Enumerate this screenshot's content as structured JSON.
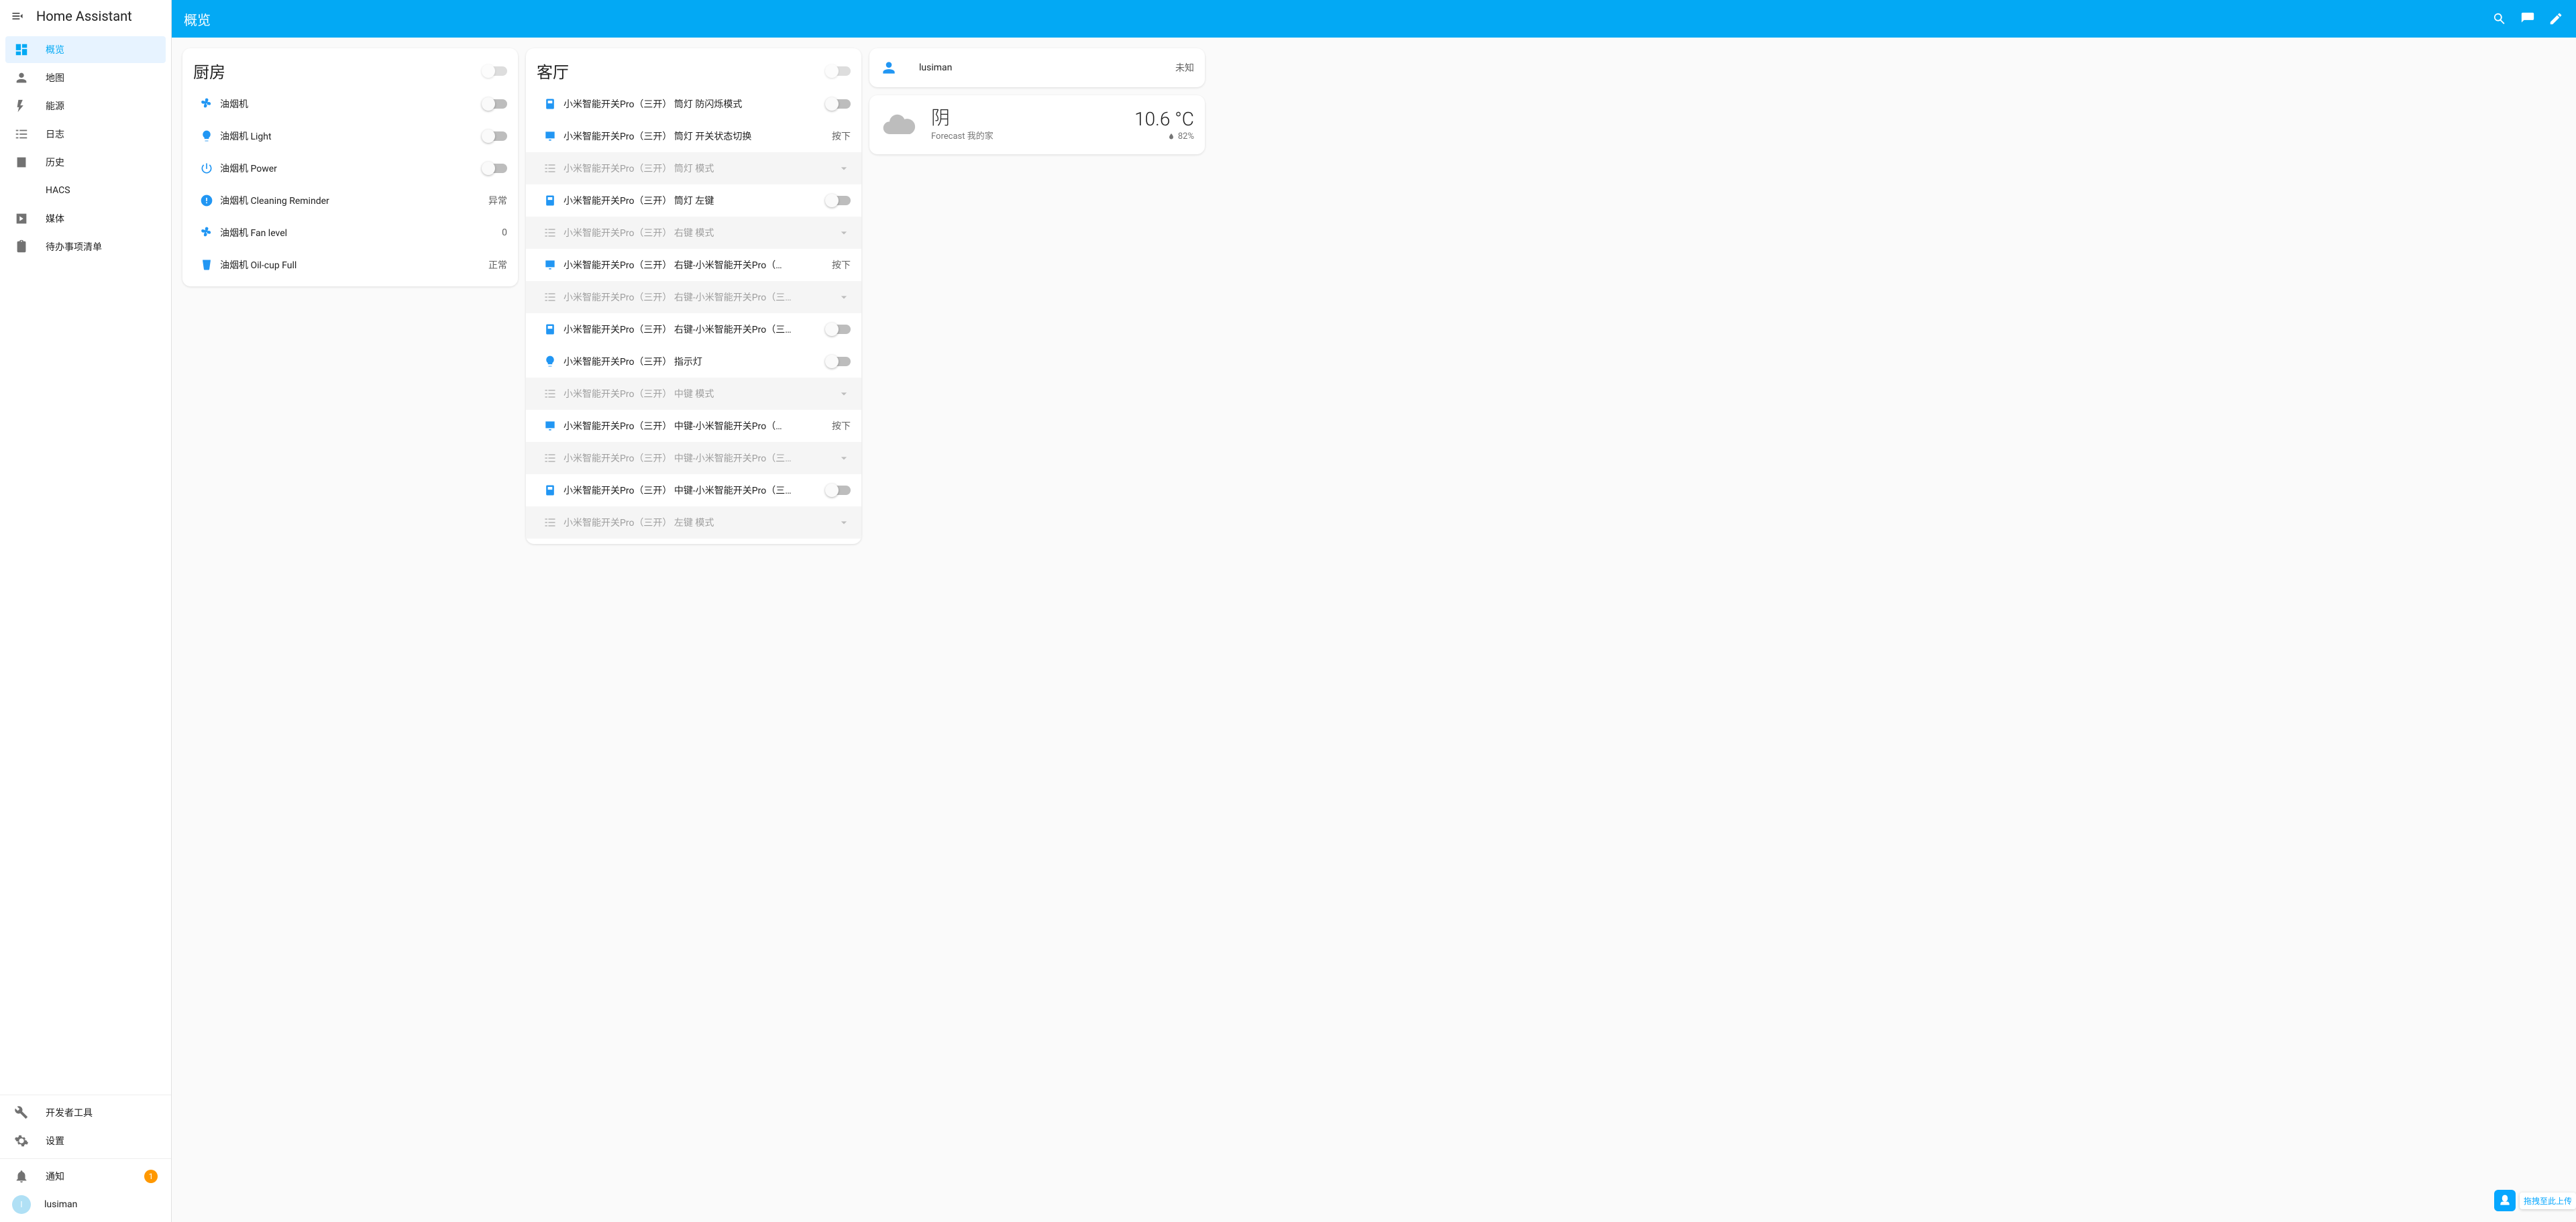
{
  "appTitle": "Home Assistant",
  "pageTitle": "概览",
  "sidebar": {
    "items": [
      {
        "label": "概览",
        "active": true
      },
      {
        "label": "地图"
      },
      {
        "label": "能源"
      },
      {
        "label": "日志"
      },
      {
        "label": "历史"
      },
      {
        "label": "HACS"
      },
      {
        "label": "媒体"
      },
      {
        "label": "待办事项清单"
      }
    ],
    "tools": [
      {
        "label": "开发者工具"
      },
      {
        "label": "设置"
      }
    ],
    "notifications": {
      "label": "通知",
      "count": "1"
    },
    "user": {
      "label": "lusiman",
      "initial": "l"
    }
  },
  "cards": {
    "kitchen": {
      "title": "厨房",
      "entities": [
        {
          "icon": "fan",
          "label": "油烟机",
          "kind": "toggle",
          "on": false
        },
        {
          "icon": "bulb",
          "label": "油烟机 Light",
          "kind": "toggle",
          "on": false
        },
        {
          "icon": "power",
          "label": "油烟机 Power",
          "kind": "toggle",
          "on": false
        },
        {
          "icon": "alert",
          "label": "油烟机 Cleaning Reminder",
          "kind": "value",
          "value": "异常"
        },
        {
          "icon": "fan",
          "label": "油烟机 Fan level",
          "kind": "value",
          "value": "0"
        },
        {
          "icon": "cup",
          "label": "油烟机 Oil-cup Full",
          "kind": "value",
          "value": "正常"
        }
      ]
    },
    "living": {
      "title": "客厅",
      "entities": [
        {
          "icon": "switch",
          "label": "小米智能开关Pro（三开） 筒灯 防闪烁模式",
          "kind": "toggle",
          "on": false
        },
        {
          "icon": "press",
          "label": "小米智能开关Pro（三开） 筒灯 开关状态切换",
          "kind": "button",
          "value": "按下"
        },
        {
          "icon": "list",
          "label": "小米智能开关Pro（三开） 筒灯 模式",
          "kind": "select",
          "disabled": true
        },
        {
          "icon": "switch",
          "label": "小米智能开关Pro（三开） 筒灯 左键",
          "kind": "toggle",
          "on": false
        },
        {
          "icon": "list",
          "label": "小米智能开关Pro（三开） 右键 模式",
          "kind": "select",
          "disabled": true
        },
        {
          "icon": "press",
          "label": "小米智能开关Pro（三开） 右键-小米智能开关Pro（…",
          "kind": "button",
          "value": "按下"
        },
        {
          "icon": "list",
          "label": "小米智能开关Pro（三开） 右键-小米智能开关Pro（三…",
          "kind": "select",
          "disabled": true
        },
        {
          "icon": "switch",
          "label": "小米智能开关Pro（三开） 右键-小米智能开关Pro（三…",
          "kind": "toggle",
          "on": false
        },
        {
          "icon": "bulb",
          "label": "小米智能开关Pro（三开） 指示灯",
          "kind": "toggle",
          "on": false
        },
        {
          "icon": "list",
          "label": "小米智能开关Pro（三开） 中键 模式",
          "kind": "select",
          "disabled": true
        },
        {
          "icon": "press",
          "label": "小米智能开关Pro（三开） 中键-小米智能开关Pro（…",
          "kind": "button",
          "value": "按下"
        },
        {
          "icon": "list",
          "label": "小米智能开关Pro（三开） 中键-小米智能开关Pro（三…",
          "kind": "select",
          "disabled": true
        },
        {
          "icon": "switch",
          "label": "小米智能开关Pro（三开） 中键-小米智能开关Pro（三…",
          "kind": "toggle",
          "on": false
        },
        {
          "icon": "list",
          "label": "小米智能开关Pro（三开） 左键 模式",
          "kind": "select",
          "disabled": true
        }
      ]
    },
    "person": {
      "name": "lusiman",
      "state": "未知"
    },
    "weather": {
      "state": "阴",
      "name": "Forecast 我的家",
      "temp": "10.6 °C",
      "humidity": "82%"
    }
  },
  "fab": {
    "label": "拖拽至此上传"
  }
}
